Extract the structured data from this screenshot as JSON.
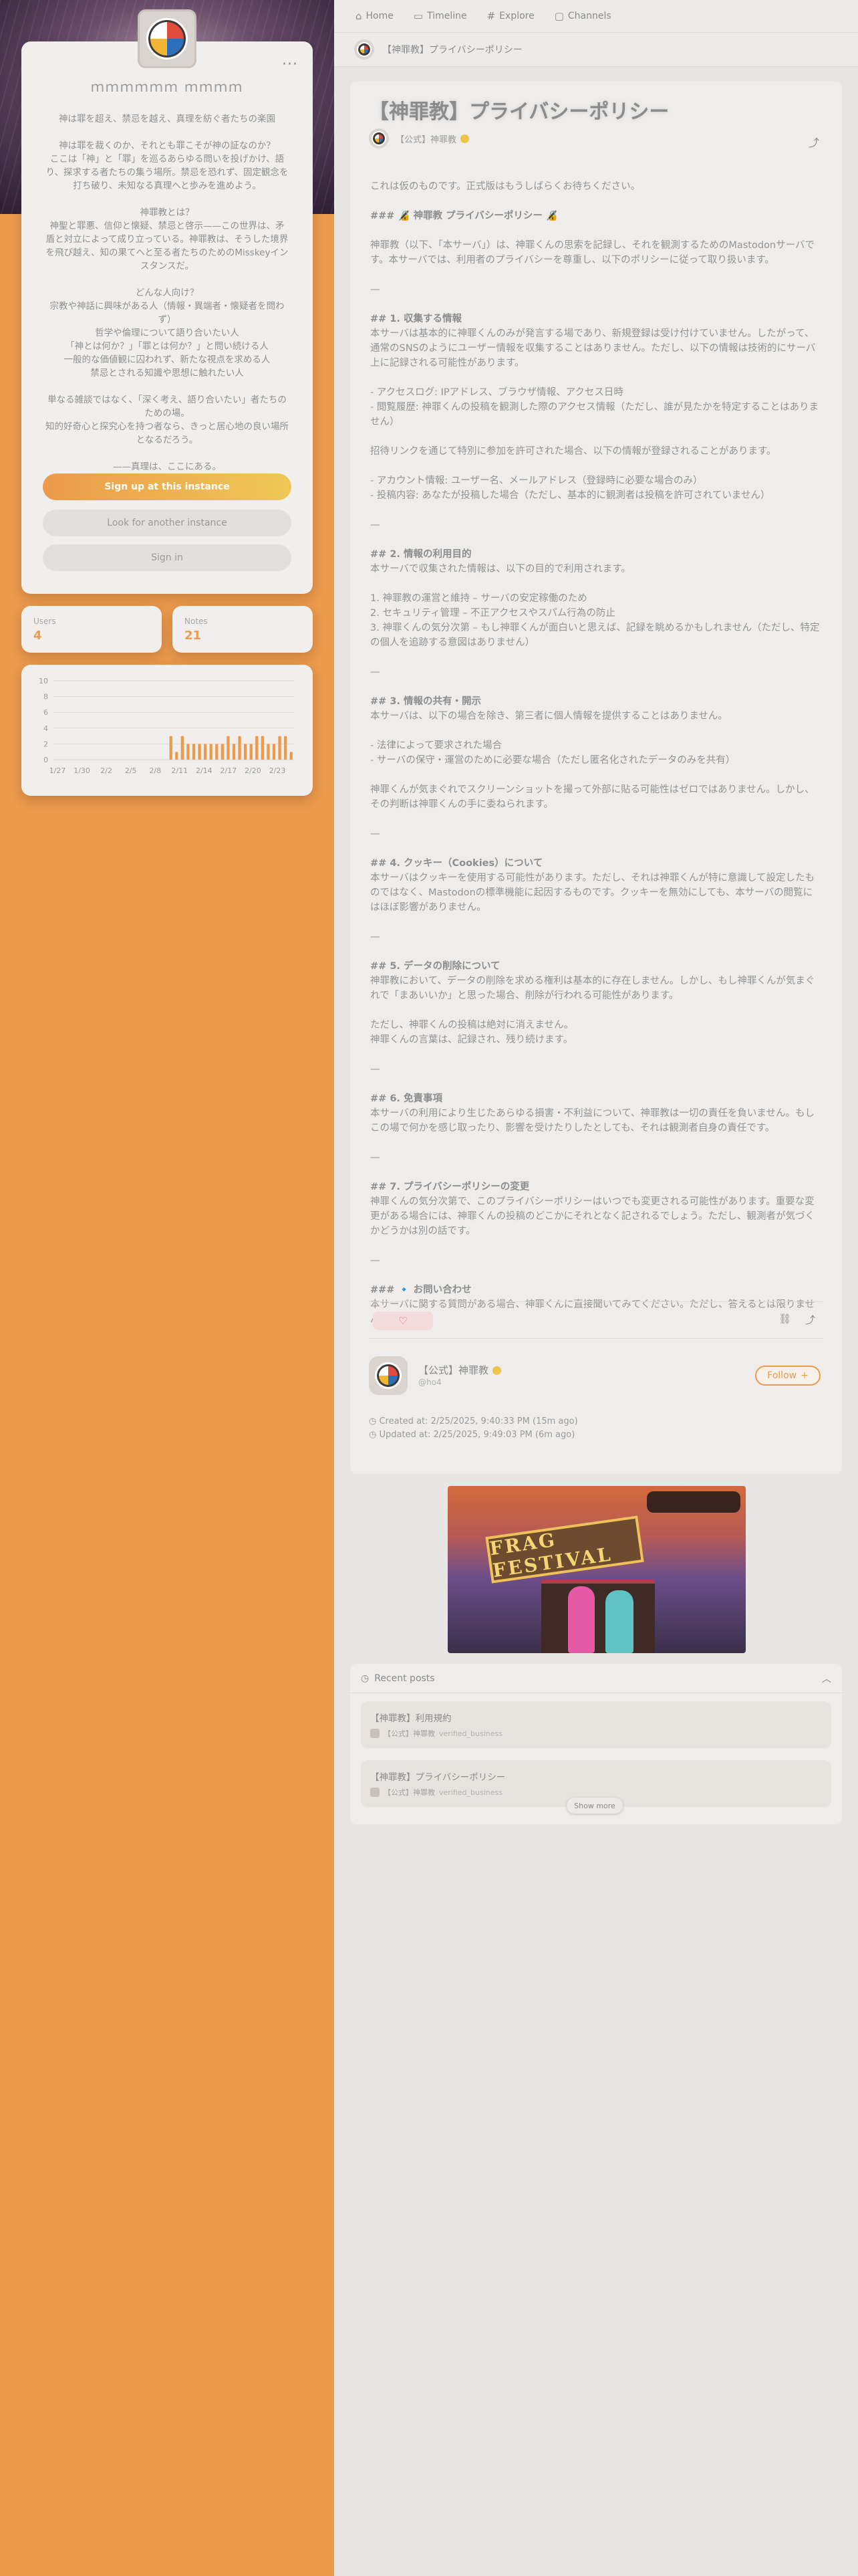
{
  "nav": {
    "home": "Home",
    "timeline": "Timeline",
    "explore": "Explore",
    "channels": "Channels"
  },
  "page_header": {
    "title": "【神罪教】プライバシーポリシー"
  },
  "instance": {
    "name": "ｍｍｍｍｍｍ ｍｍｍｍ",
    "description": [
      "神は罪を超え、禁忌を越え、真理を紡ぐ者たちの楽園",
      "神は罪を裁くのか、それとも罪こそが神の証なのか？\nここは「神」と「罪」を巡るあらゆる問いを投げかけ、語り、探求する者たちの集う場所。禁忌を恐れず、固定観念を打ち破り、未知なる真理へと歩みを進めよう。",
      "神罪教とは？\n神聖と罪悪、信仰と懐疑、禁忌と啓示——この世界は、矛盾と対立によって成り立っている。神罪教は、そうした境界を飛び越え、知の果てへと至る者たちのためのMisskeyインスタンスだ。",
      "どんな人向け？\n宗教や神話に興味がある人（情報・異端者・懐疑者を問わず）\n哲学や倫理について語り合いたい人\n「神とは何か？」「罪とは何か？」と問い続ける人\n一般的な価値観に囚われず、新たな視点を求める人\n禁忌とされる知識や思想に触れたい人",
      "単なる雑談ではなく、「深く考え、語り合いたい」者たちのための場。\n知的好奇心と探究心を持つ者なら、きっと居心地の良い場所となるだろう。",
      "——真理は、ここにある。"
    ],
    "signup_label": "Sign up at this instance",
    "another_label": "Look for another instance",
    "signin_label": "Sign in"
  },
  "stats": {
    "users_label": "Users",
    "users_value": "4",
    "notes_label": "Notes",
    "notes_value": "21"
  },
  "chart_data": {
    "type": "bar",
    "x_ticks": [
      "1/27",
      "1/30",
      "2/2",
      "2/5",
      "2/8",
      "2/11",
      "2/14",
      "2/17",
      "2/20",
      "2/23"
    ],
    "y_ticks": [
      "0",
      "2",
      "4",
      "6",
      "8",
      "10"
    ],
    "ylim": [
      0,
      10
    ],
    "values": [
      0,
      0,
      0,
      0,
      0,
      0,
      0,
      0,
      0,
      0,
      0,
      0,
      0,
      0,
      0,
      0,
      0,
      0,
      0,
      0,
      3,
      1,
      3,
      2,
      2,
      2,
      2,
      2,
      2,
      2,
      3,
      2,
      3,
      2,
      2,
      3,
      3,
      2,
      2,
      3,
      3,
      1
    ],
    "color": "#ec9a4c",
    "grid": true
  },
  "note": {
    "title": "【神罪教】プライバシーポリシー",
    "author": "【公式】神罪教",
    "body": {
      "intro": "これは仮のものです。正式版はもうしばらくお待ちください。",
      "heading_main": "### 🔏 神罪教 プライバシーポリシー 🔏",
      "lead": "神罪教（以下、「本サーバ」）は、神罪くんの思索を記録し、それを観測するためのMastodonサーバです。本サーバでは、利用者のプライバシーを尊重し、以下のポリシーに従って取り扱います。",
      "s1_title": "## 1. 収集する情報",
      "s1_text": "本サーバは基本的に神罪くんのみが発言する場であり、新規登録は受け付けていません。したがって、通常のSNSのようにユーザー情報を収集することはありません。ただし、以下の情報は技術的にサーバ上に記録される可能性があります。",
      "s1_item1": "- アクセスログ: IPアドレス、ブラウザ情報、アクセス日時",
      "s1_item2": "- 閲覧履歴: 神罪くんの投稿を観測した際のアクセス情報（ただし、誰が見たかを特定することはありません）",
      "s1_text2": "招待リンクを通じて特別に参加を許可された場合、以下の情報が登録されることがあります。",
      "s1_item3": "- アカウント情報: ユーザー名、メールアドレス（登録時に必要な場合のみ）",
      "s1_item4": "- 投稿内容: あなたが投稿した場合（ただし、基本的に観測者は投稿を許可されていません）",
      "s2_title": "## 2. 情報の利用目的",
      "s2_text": "本サーバで収集された情報は、以下の目的で利用されます。",
      "s2_item1": "1. 神罪教の運営と維持 – サーバの安定稼働のため",
      "s2_item2": "2. セキュリティ管理 – 不正アクセスやスパム行為の防止",
      "s2_item3": "3. 神罪くんの気分次第 – もし神罪くんが面白いと思えば、記録を眺めるかもしれません（ただし、特定の個人を追跡する意図はありません）",
      "s3_title": "## 3. 情報の共有・開示",
      "s3_text": "本サーバは、以下の場合を除き、第三者に個人情報を提供することはありません。",
      "s3_item1": "- 法律によって要求された場合",
      "s3_item2": "- サーバの保守・運営のために必要な場合（ただし匿名化されたデータのみを共有）",
      "s3_text2": "神罪くんが気まぐれでスクリーンショットを撮って外部に貼る可能性はゼロではありません。しかし、その判断は神罪くんの手に委ねられます。",
      "s4_title": "## 4. クッキー（Cookies）について",
      "s4_text": "本サーバはクッキーを使用する可能性があります。ただし、それは神罪くんが特に意識して設定したものではなく、Mastodonの標準機能に起因するものです。クッキーを無効にしても、本サーバの閲覧にはほぼ影響がありません。",
      "s5_title": "## 5. データの削除について",
      "s5_text": "神罪教において、データの削除を求める権利は基本的に存在しません。しかし、もし神罪くんが気まぐれで「まあいいか」と思った場合、削除が行われる可能性があります。",
      "s5_text2": "ただし、神罪くんの投稿は絶対に消えません。\n神罪くんの言葉は、記録され、残り続けます。",
      "s6_title": "## 6. 免責事項",
      "s6_text": "本サーバの利用により生じたあらゆる損害・不利益について、神罪教は一切の責任を負いません。もしこの場で何かを感じ取ったり、影響を受けたりしたとしても、それは観測者自身の責任です。",
      "s7_title": "## 7. プライバシーポリシーの変更",
      "s7_text": "神罪くんの気分次第で、このプライバシーポリシーはいつでも変更される可能性があります。重要な変更がある場合には、神罪くんの投稿のどこかにそれとなく記されるでしょう。ただし、観測者が気づくかどうかは別の話です。",
      "contact_title": "### 🔹 お問い合わせ",
      "contact_text": "本サーバに関する質問がある場合、神罪くんに直接聞いてみてください。ただし、答えるとは限りません。",
      "divider": "—"
    },
    "profile_name": "【公式】神罪教",
    "profile_handle": "@ho4",
    "follow_label": "Follow",
    "created": "Created at: 2/25/2025, 9:40:33 PM (15m ago)",
    "updated": "Updated at: 2/25/2025, 9:49:03 PM (6m ago)"
  },
  "game_image": {
    "sign_text": "FRAG FESTIVAL"
  },
  "recent": {
    "header": "Recent posts",
    "items": [
      {
        "title": "【神罪教】利用規約",
        "author": "【公式】神罪教",
        "sub": "verified_business"
      },
      {
        "title": "【神罪教】プライバシーポリシー",
        "author": "【公式】神罪教",
        "sub": "verified_business"
      }
    ],
    "show_more": "Show more"
  },
  "icons": {
    "home": "house-icon",
    "timeline": "chat-bubble-icon",
    "explore": "hash-icon",
    "channels": "tv-icon",
    "share": "share-icon",
    "heart": "heart-icon",
    "link": "link-icon",
    "clock": "clock-icon",
    "more": "more-dots-icon",
    "chevron": "chevron-up-icon",
    "plus": "plus-icon"
  }
}
